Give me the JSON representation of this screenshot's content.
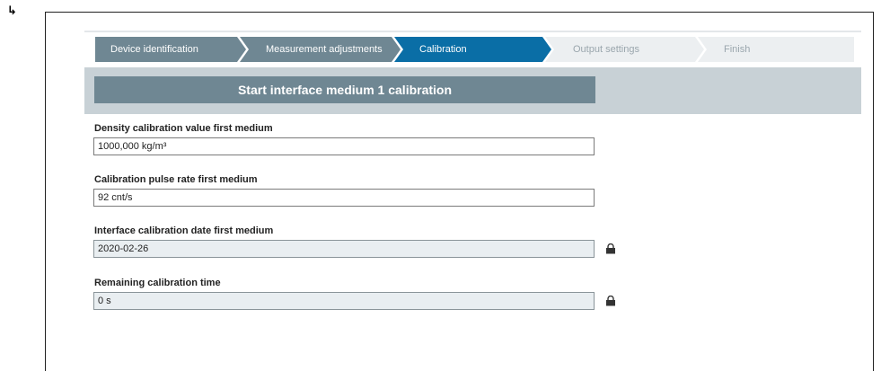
{
  "marker": {
    "arrow": "↳"
  },
  "wizard": {
    "steps": [
      {
        "label": "Device identification",
        "state": "done"
      },
      {
        "label": "Measurement adjustments",
        "state": "done"
      },
      {
        "label": "Calibration",
        "state": "active"
      },
      {
        "label": "Output settings",
        "state": "pending"
      },
      {
        "label": "Finish",
        "state": "pending"
      }
    ]
  },
  "banner": {
    "title": "Start interface medium 1 calibration"
  },
  "fields": [
    {
      "label": "Density calibration value first medium",
      "value": "1000,000 kg/m³",
      "readonly": false
    },
    {
      "label": "Calibration pulse rate first medium",
      "value": "92 cnt/s",
      "readonly": false
    },
    {
      "label": "Interface calibration date first medium",
      "value": "2020-02-26",
      "readonly": true,
      "icon": "lock-icon"
    },
    {
      "label": "Remaining calibration time",
      "value": "0 s",
      "readonly": true,
      "icon": "lock-icon"
    }
  ],
  "colors": {
    "step_done": "#6f8793",
    "step_active": "#0a6ea6",
    "step_pending": "#eceff1",
    "banner_bg": "#c8d1d6",
    "title_bg": "#6f8793"
  }
}
